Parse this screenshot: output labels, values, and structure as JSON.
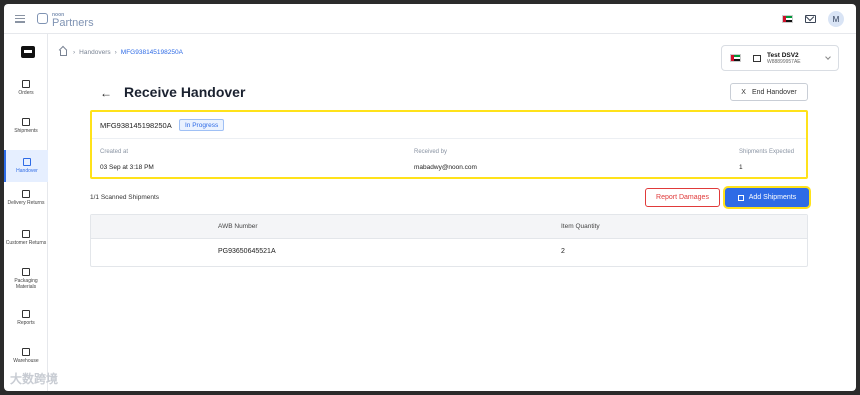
{
  "brand": {
    "line1": "noon",
    "line2": "Partners"
  },
  "header": {
    "avatar_initial": "M"
  },
  "sidebar": {
    "items": [
      {
        "label": "Orders"
      },
      {
        "label": "Shipments"
      },
      {
        "label": "Handover"
      },
      {
        "label": "Delivery Returns"
      },
      {
        "label": "Customer Returns"
      },
      {
        "label": "Packaging Materials"
      },
      {
        "label": "Reports"
      },
      {
        "label": "Warehouse"
      }
    ],
    "active_index": 2
  },
  "breadcrumb": {
    "parent": "Handovers",
    "current": "MFG938145198250A"
  },
  "store": {
    "name": "Test DSV2",
    "code": "W88899957AE"
  },
  "page": {
    "title": "Receive Handover",
    "end_button": "End Handover",
    "end_icon": "X"
  },
  "handover": {
    "id": "MFG938145198250A",
    "status": "In Progress",
    "created_label": "Created at",
    "created_value": "03 Sep at 3:18 PM",
    "received_label": "Received by",
    "received_value": "mabadwy@noon.com",
    "expected_label": "Shipments Expected",
    "expected_value": "1"
  },
  "scanned": {
    "text": "1/1 Scanned Shipments"
  },
  "actions": {
    "report": "Report Damages",
    "add": "Add Shipments"
  },
  "table": {
    "columns": [
      "AWB Number",
      "Item Quantity"
    ],
    "rows": [
      {
        "awb": "PG93650645521A",
        "qty": "2"
      }
    ]
  },
  "colors": {
    "accent": "#2e6be6",
    "highlight": "#ffe21a",
    "danger": "#e03a3a"
  },
  "watermark": "大数跨境"
}
